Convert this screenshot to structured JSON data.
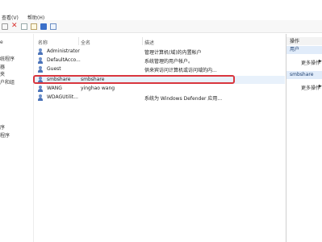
{
  "menu": {
    "view_label": "查看(V)",
    "help_label": "帮助(H)"
  },
  "tree": {
    "items": [
      "e",
      "统程序",
      "器",
      "夹",
      "户和组",
      "",
      "",
      "",
      "序",
      "程序"
    ]
  },
  "table": {
    "headers": {
      "name": "名称",
      "full_name": "全名",
      "description": "描述"
    },
    "rows": [
      {
        "name": "Administrator",
        "full_name": "",
        "description": "管理计算机(域)的内置帐户"
      },
      {
        "name": "DefaultAcco...",
        "full_name": "",
        "description": "系统管理的用户帐户。"
      },
      {
        "name": "Guest",
        "full_name": "",
        "description": "供来宾访问计算机或访问域的内..."
      },
      {
        "name": "smbshare",
        "full_name": "smbshare",
        "description": ""
      },
      {
        "name": "WANG",
        "full_name": "yinghao wang",
        "description": ""
      },
      {
        "name": "WDAGUtilit...",
        "full_name": "",
        "description": "系统为 Windows Defender 应用..."
      }
    ],
    "selected_row": "smbshare"
  },
  "actions": {
    "title": "操作",
    "section_users": "用户",
    "more_actions_1": "更多操作",
    "section_selected": "smbshare",
    "more_actions_2": "更多操作"
  },
  "colors": {
    "highlight_border": "#d9363e",
    "action_section_bg": "#e1ecfa",
    "user_icon": "#4a72b8"
  },
  "icons": [
    "back-icon",
    "delete-icon",
    "properties-icon",
    "export-icon",
    "help-icon",
    "view-icon",
    "user-icon"
  ]
}
